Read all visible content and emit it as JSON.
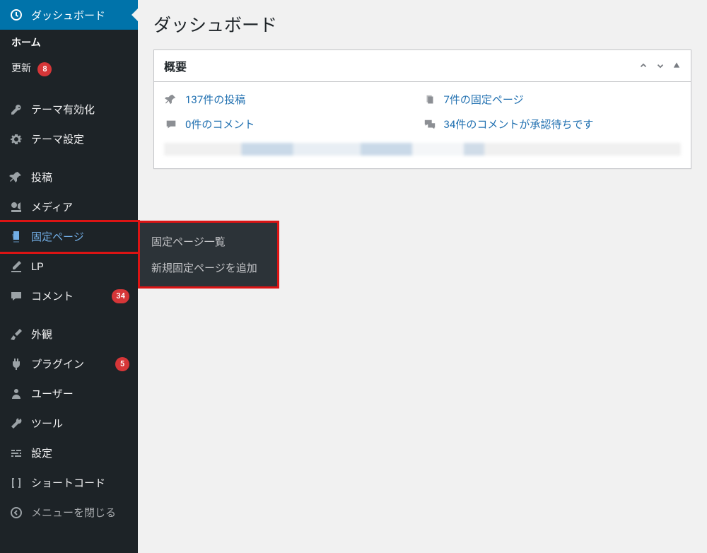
{
  "page_title": "ダッシュボード",
  "sidebar": {
    "dashboard": "ダッシュボード",
    "home": "ホーム",
    "updates": "更新",
    "updates_count": "8",
    "theme_activate": "テーマ有効化",
    "theme_settings": "テーマ設定",
    "posts": "投稿",
    "media": "メディア",
    "pages": "固定ページ",
    "lp": "LP",
    "comments": "コメント",
    "comments_count": "34",
    "appearance": "外観",
    "plugins": "プラグイン",
    "plugins_count": "5",
    "users": "ユーザー",
    "tools": "ツール",
    "settings": "設定",
    "shortcode": "ショートコード",
    "collapse": "メニューを閉じる"
  },
  "flyout": {
    "all_pages": "固定ページ一覧",
    "add_new": "新規固定ページを追加"
  },
  "overview": {
    "title": "概要",
    "posts_link": "137件の投稿",
    "comments_link": "0件のコメント",
    "pages_link": "7件の固定ページ",
    "pending_link": "34件のコメントが承認待ちです"
  }
}
